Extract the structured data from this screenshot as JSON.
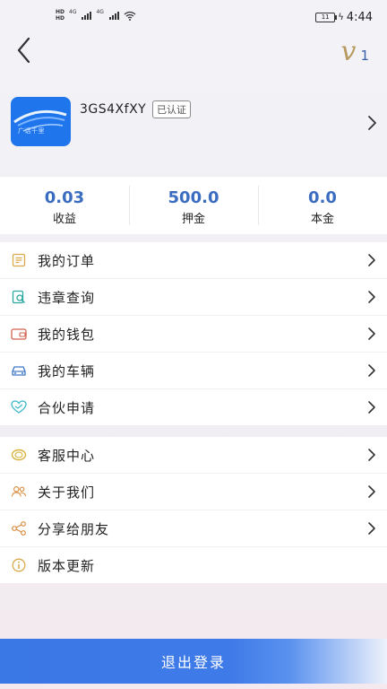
{
  "status_bar": {
    "hd1": "HD",
    "hd2": "HD",
    "net1": "4G",
    "net2": "4G",
    "battery": "11",
    "time": "4:44"
  },
  "header": {
    "vip_letter": "v",
    "vip_level": "1"
  },
  "profile": {
    "avatar_text": "广话千里",
    "username": "3GS4XfXY",
    "verified_badge": "已认证"
  },
  "stats": [
    {
      "value": "0.03",
      "label": "收益"
    },
    {
      "value": "500.0",
      "label": "押金"
    },
    {
      "value": "0.0",
      "label": "本金"
    }
  ],
  "menu_primary": [
    {
      "label": "我的订单",
      "icon": "order-list-icon"
    },
    {
      "label": "违章查询",
      "icon": "violation-search-icon"
    },
    {
      "label": "我的钱包",
      "icon": "wallet-icon"
    },
    {
      "label": "我的车辆",
      "icon": "car-icon"
    },
    {
      "label": "合伙申请",
      "icon": "partnership-heart-icon"
    }
  ],
  "menu_secondary": [
    {
      "label": "客服中心",
      "icon": "customer-service-icon"
    },
    {
      "label": "关于我们",
      "icon": "about-us-icon"
    },
    {
      "label": "分享给朋友",
      "icon": "share-icon"
    },
    {
      "label": "版本更新",
      "icon": "info-icon"
    }
  ],
  "logout_label": "退出登录",
  "colors": {
    "accent_blue": "#3a6cc0",
    "vip_gold": "#b79a5f",
    "logout_blue": "#3a78e6"
  }
}
